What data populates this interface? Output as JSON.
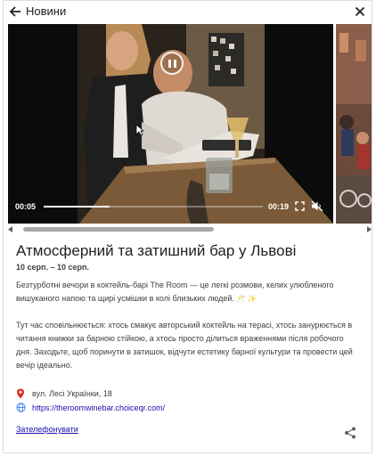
{
  "header": {
    "title": "Новини"
  },
  "video": {
    "current_time": "00:05",
    "duration": "00:19",
    "progress": 0.3
  },
  "article": {
    "title": "Атмосферний та затишний бар у Львові",
    "dates": "10 серп. – 10 серп.",
    "paragraph1": "Безтурботні вечори в коктейль-барі The Room — це легкі розмови, келих улюбленого вишуканого напою та щирі усмішки в колі близьких людей.",
    "paragraph1_emoji": [
      "🥂",
      "✨"
    ],
    "paragraph2": "Тут час сповільнюється: хтось смакує авторський коктейль на терасі, хтось занурюється в читання книжки за барною стійкою, а хтось просто ділиться враженнями після робочого дня. Заходьте, щоб поринути в затишок, відчути естетику барної культури та провести цей вечір ідеально."
  },
  "details": {
    "address": "вул. Лесі Українки, 18",
    "website": "https://theroomwinebar.choiceqr.com/"
  },
  "actions": {
    "call": "Зателефонувати"
  },
  "colors": {
    "link": "#1a0dab",
    "pin": "#d93025",
    "text": "#202124"
  },
  "icons": {
    "back": "arrow-left-icon",
    "close": "close-icon",
    "pause": "pause-icon",
    "fullscreen": "fullscreen-icon",
    "mute": "volume-muted-icon",
    "pin": "location-pin-icon",
    "globe": "globe-icon",
    "share": "share-icon"
  }
}
